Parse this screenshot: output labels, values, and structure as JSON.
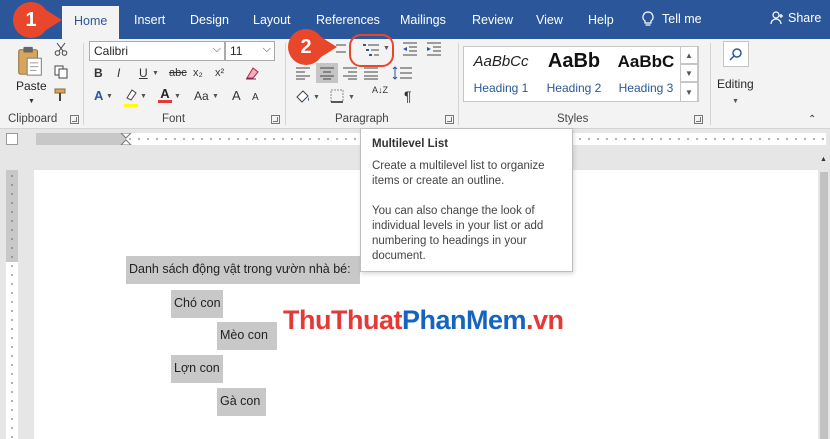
{
  "tabs": [
    {
      "label": "Home",
      "active": true
    },
    {
      "label": "Insert"
    },
    {
      "label": "Design"
    },
    {
      "label": "Layout"
    },
    {
      "label": "References"
    },
    {
      "label": "Mailings"
    },
    {
      "label": "Review"
    },
    {
      "label": "View"
    },
    {
      "label": "Help"
    }
  ],
  "tell_me": "Tell me",
  "share": "Share",
  "clipboard": {
    "paste_label": "Paste",
    "group_label": "Clipboard"
  },
  "font": {
    "name": "Calibri",
    "size": "11",
    "group_label": "Font",
    "bold": "B",
    "italic": "I",
    "underline": "U",
    "strike": "abc",
    "subscript": "x₂",
    "superscript": "x²",
    "change_case": "Aa",
    "text_effects": "A",
    "font_color": "A",
    "grow": "A",
    "shrink": "A"
  },
  "paragraph": {
    "group_label": "Paragraph",
    "sort": "A↓Z",
    "show_marks": "¶"
  },
  "styles": {
    "group_label": "Styles",
    "items": [
      {
        "sample": "AaBbCc",
        "name": "Heading 1"
      },
      {
        "sample": "AaBb",
        "name": "Heading 2"
      },
      {
        "sample": "AaBbC",
        "name": "Heading 3"
      }
    ]
  },
  "editing": {
    "label": "Editing"
  },
  "tooltip": {
    "title": "Multilevel List",
    "para1": "Create a multilevel list to organize items or create an outline.",
    "para2": "You can also change the look of individual levels in your list or add numbering to headings in your document."
  },
  "document": {
    "lines": [
      "Danh sách động vật trong vườn nhà bé:",
      "Chó con",
      "Mèo con",
      "Lợn con",
      "Gà con"
    ]
  },
  "watermark": {
    "part1": "ThuThuat",
    "part2": "PhanMem",
    "part3": ".vn"
  },
  "callouts": [
    "1",
    "2"
  ],
  "colors": {
    "tab_blue": "#2b579a",
    "ribbon_bg": "#f3f3f3",
    "callout_red": "#e8472b",
    "highlight_yellow": "#ffff00",
    "font_red": "#e53935"
  }
}
